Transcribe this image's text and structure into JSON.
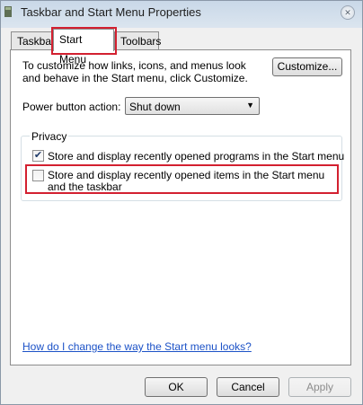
{
  "window": {
    "title": "Taskbar and Start Menu Properties",
    "close_glyph": "✕",
    "icon": "taskbar-window-icon"
  },
  "tabs": [
    {
      "label": "Taskbar",
      "active": false
    },
    {
      "label": "Start Menu",
      "active": true
    },
    {
      "label": "Toolbars",
      "active": false
    }
  ],
  "start_menu": {
    "description": "To customize how links, icons, and menus look and behave in the Start menu, click Customize.",
    "customize_label": "Customize...",
    "power_label": "Power button action:",
    "power_value": "Shut down",
    "privacy": {
      "title": "Privacy",
      "programs_label": "Store and display recently opened programs in the Start menu",
      "programs_checked": true,
      "items_label": "Store and display recently opened items in the Start menu and the taskbar",
      "items_checked": false
    },
    "help_link": "How do I change the way the Start menu looks?"
  },
  "footer": {
    "ok_label": "OK",
    "cancel_label": "Cancel",
    "apply_label": "Apply"
  },
  "colors": {
    "highlight": "#d32030",
    "link": "#1c52c7"
  }
}
